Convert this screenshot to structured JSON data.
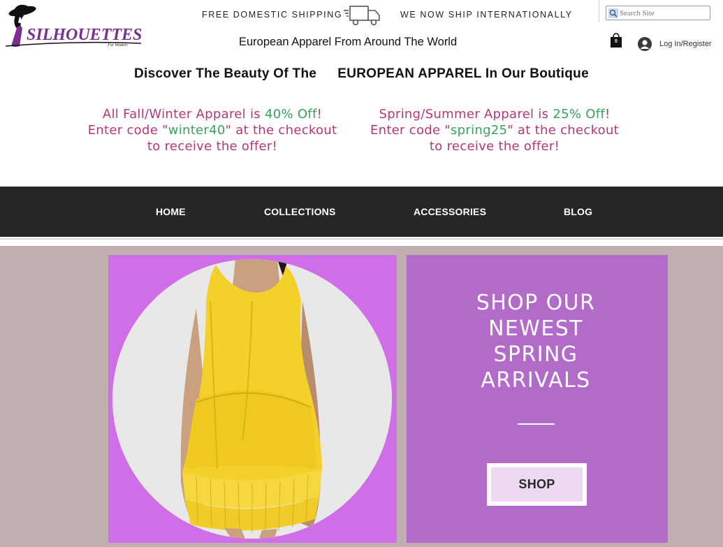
{
  "brand": {
    "name": "SILHOUETTES",
    "sub": "For Women",
    "accent": "#7a2e8f"
  },
  "header": {
    "shipping_left": "FREE DOMESTIC SHIPPING",
    "shipping_right": "WE NOW SHIP INTERNATIONALLY",
    "tagline": "European Apparel From Around The World",
    "search_placeholder": "Search Site",
    "cart_count": "0",
    "login_label": "Log In/Register"
  },
  "announcement": {
    "discover_a": "Discover The Beauty Of The",
    "discover_b": "EUROPEAN APPAREL In Our Boutique"
  },
  "promos": [
    {
      "line1_a": "All Fall/Winter Apparel is ",
      "discount": "40% Off",
      "line1_b": "!",
      "line2_a": "Enter code \"",
      "code": "winter40",
      "line2_b": "\" at the checkout",
      "line3": "to receive the offer!"
    },
    {
      "line1_a": "Spring/Summer Apparel is ",
      "discount": "25% Off",
      "line1_b": "!",
      "line2_a": "Enter code \"",
      "code": "spring25",
      "line2_b": "\" at the checkout",
      "line3": "to receive the offer!"
    }
  ],
  "nav": {
    "items": [
      {
        "label": "HOME"
      },
      {
        "label": "COLLECTIONS"
      },
      {
        "label": "ACCESSORIES"
      },
      {
        "label": "BLOG"
      }
    ]
  },
  "hero": {
    "title_lines": [
      "SHOP OUR",
      "NEWEST",
      "SPRING",
      "ARRIVALS"
    ],
    "button_label": "SHOP",
    "colors": {
      "background": "#c0afaf",
      "photo_frame": "#cf6ee6",
      "cta_panel": "#b26bc9",
      "dress": "#f3d12a"
    }
  },
  "colors": {
    "promo_text": "#b6377a",
    "promo_highlight": "#35a55b",
    "navbar": "#262626"
  },
  "icons": [
    "logo-hat-icon",
    "truck-icon",
    "search-icon",
    "cart-icon",
    "user-avatar-icon"
  ]
}
